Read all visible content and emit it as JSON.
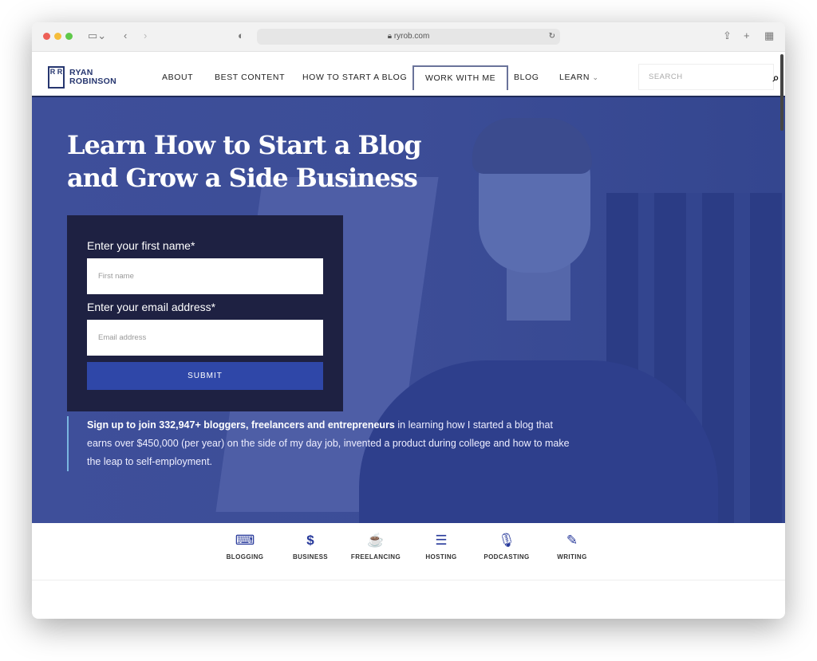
{
  "browser": {
    "url": "ryrob.com",
    "lock": "lock-icon"
  },
  "logo": {
    "line1": "RYAN",
    "line2": "ROBINSON",
    "mark": "R R"
  },
  "nav": {
    "items": [
      "ABOUT",
      "BEST CONTENT",
      "HOW TO START A BLOG",
      "WORK WITH ME",
      "BLOG",
      "LEARN"
    ],
    "learn_chevron": "⌄",
    "search_placeholder": "SEARCH"
  },
  "hero": {
    "title_line1": "Learn How to Start a Blog",
    "title_line2": "and Grow a Side Business",
    "form": {
      "first_label": "Enter your first name*",
      "first_placeholder": "First name",
      "email_label": "Enter your email address*",
      "email_placeholder": "Email address",
      "submit": "SUBMIT"
    },
    "blurb_bold": "Sign up to join 332,947+ bloggers, freelancers and entrepreneurs",
    "blurb_rest": " in learning how I started a blog that earns over $450,000 (per year) on the side of my day job, invented a product during college and how to make the leap to self-employment."
  },
  "categories": [
    {
      "label": "BLOGGING",
      "icon": "⌨"
    },
    {
      "label": "BUSINESS",
      "icon": "$"
    },
    {
      "label": "FREELANCING",
      "icon": "☕"
    },
    {
      "label": "HOSTING",
      "icon": "☰"
    },
    {
      "label": "PODCASTING",
      "icon": "🎙"
    },
    {
      "label": "WRITING",
      "icon": "✎"
    }
  ],
  "colors": {
    "brand": "#26366f",
    "hero": "#3e4f9a",
    "form": "#1e2142",
    "submit": "#2f47a8"
  }
}
